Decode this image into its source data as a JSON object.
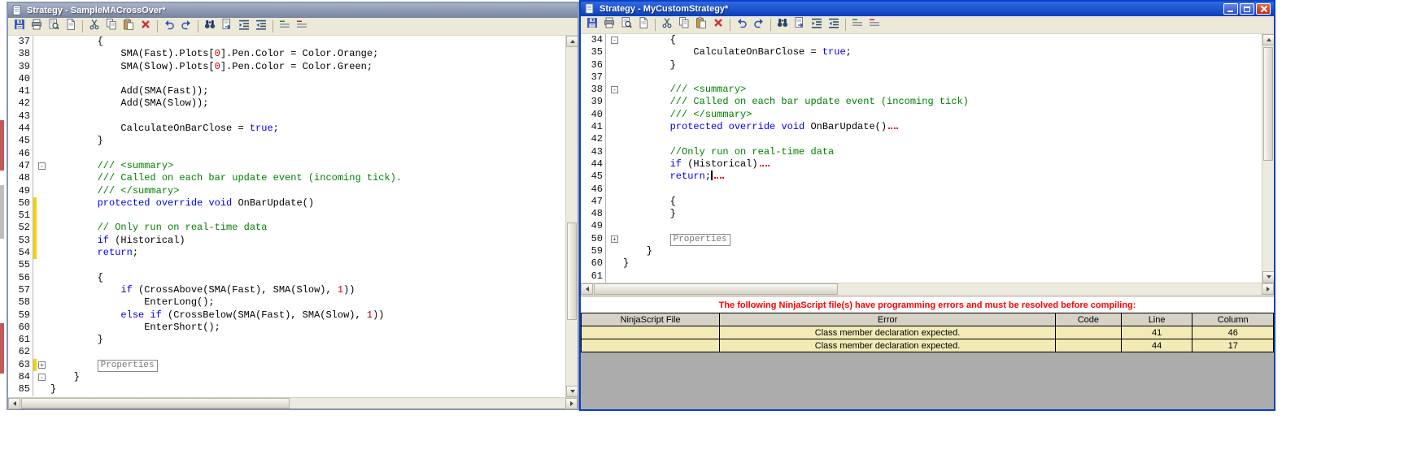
{
  "colors": {
    "keyword": "#0000FF",
    "comment": "#008000",
    "number": "#C00000",
    "error_text": "#FF0000",
    "error_row_bg": "#F2EBB6",
    "table_header_bg": "#D6D2C6",
    "active_title_from": "#2E6BE5",
    "active_title_to": "#0A3EB8",
    "inactive_title_from": "#A8B2C8",
    "inactive_title_to": "#76839E"
  },
  "left_window": {
    "title": "Strategy - SampleMACrossOver*",
    "toolbar": [
      "save",
      "print",
      "print-preview",
      "page-find",
      "sep",
      "cut",
      "copy",
      "paste",
      "delete",
      "sep",
      "undo",
      "redo",
      "sep",
      "find",
      "goto-line",
      "indent",
      "outdent",
      "sep",
      "comment",
      "uncomment"
    ],
    "code_lines": [
      {
        "n": "37",
        "seg": [
          [
            "p",
            "        {"
          ]
        ]
      },
      {
        "n": "38",
        "seg": [
          [
            "p",
            "            SMA(Fast).Plots["
          ],
          [
            "num",
            "0"
          ],
          [
            "p",
            "].Pen.Color = Color.Orange;"
          ]
        ]
      },
      {
        "n": "39",
        "seg": [
          [
            "p",
            "            SMA(Slow).Plots["
          ],
          [
            "num",
            "0"
          ],
          [
            "p",
            "].Pen.Color = Color.Green;"
          ]
        ]
      },
      {
        "n": "40",
        "seg": []
      },
      {
        "n": "41",
        "seg": [
          [
            "p",
            "            Add(SMA(Fast));"
          ]
        ]
      },
      {
        "n": "42",
        "seg": [
          [
            "p",
            "            Add(SMA(Slow));"
          ]
        ]
      },
      {
        "n": "43",
        "seg": []
      },
      {
        "n": "44",
        "seg": [
          [
            "p",
            "            CalculateOnBarClose = "
          ],
          [
            "k",
            "true"
          ],
          [
            "p",
            ";"
          ]
        ]
      },
      {
        "n": "45",
        "seg": [
          [
            "p",
            "        }"
          ]
        ]
      },
      {
        "n": "46",
        "seg": []
      },
      {
        "n": "47",
        "fold": "-",
        "seg": [
          [
            "c",
            "        /// <summary>"
          ]
        ]
      },
      {
        "n": "48",
        "seg": [
          [
            "c",
            "        /// Called on each bar update event (incoming tick)."
          ]
        ]
      },
      {
        "n": "49",
        "seg": [
          [
            "c",
            "        /// </summary>"
          ]
        ]
      },
      {
        "n": "50",
        "chg": true,
        "seg": [
          [
            "p",
            "        "
          ],
          [
            "k",
            "protected"
          ],
          [
            "p",
            " "
          ],
          [
            "k",
            "override"
          ],
          [
            "p",
            " "
          ],
          [
            "k",
            "void"
          ],
          [
            "p",
            " OnBarUpdate()"
          ]
        ]
      },
      {
        "n": "51",
        "chg": true,
        "seg": []
      },
      {
        "n": "52",
        "chg": true,
        "seg": [
          [
            "c",
            "        // Only run on real-time data"
          ]
        ]
      },
      {
        "n": "53",
        "chg": true,
        "seg": [
          [
            "p",
            "        "
          ],
          [
            "k",
            "if"
          ],
          [
            "p",
            " (Historical)"
          ]
        ]
      },
      {
        "n": "54",
        "chg": true,
        "seg": [
          [
            "p",
            "        "
          ],
          [
            "k",
            "return"
          ],
          [
            "p",
            ";"
          ]
        ]
      },
      {
        "n": "55",
        "seg": []
      },
      {
        "n": "56",
        "seg": [
          [
            "p",
            "        {"
          ]
        ]
      },
      {
        "n": "57",
        "seg": [
          [
            "p",
            "            "
          ],
          [
            "k",
            "if"
          ],
          [
            "p",
            " (CrossAbove(SMA(Fast), SMA(Slow), "
          ],
          [
            "num",
            "1"
          ],
          [
            "p",
            "))"
          ]
        ]
      },
      {
        "n": "58",
        "seg": [
          [
            "p",
            "                EnterLong();"
          ]
        ]
      },
      {
        "n": "59",
        "seg": [
          [
            "p",
            "            "
          ],
          [
            "k",
            "else"
          ],
          [
            "p",
            " "
          ],
          [
            "k",
            "if"
          ],
          [
            "p",
            " (CrossBelow(SMA(Fast), SMA(Slow), "
          ],
          [
            "num",
            "1"
          ],
          [
            "p",
            "))"
          ]
        ]
      },
      {
        "n": "60",
        "seg": [
          [
            "p",
            "                EnterShort();"
          ]
        ]
      },
      {
        "n": "61",
        "seg": [
          [
            "p",
            "        }"
          ]
        ]
      },
      {
        "n": "62",
        "seg": []
      },
      {
        "n": "63",
        "fold": "+",
        "chg": true,
        "seg": [
          [
            "p",
            "        "
          ],
          [
            "box",
            "Properties"
          ]
        ]
      },
      {
        "n": "84",
        "fold": "-",
        "seg": [
          [
            "p",
            "    }"
          ]
        ]
      },
      {
        "n": "85",
        "seg": [
          [
            "p",
            "}"
          ]
        ]
      }
    ]
  },
  "right_window": {
    "title": "Strategy - MyCustomStrategy*",
    "window_buttons": [
      "minimize",
      "maximize",
      "close"
    ],
    "toolbar": [
      "save",
      "print",
      "print-preview",
      "page-find",
      "sep",
      "cut",
      "copy",
      "paste",
      "delete",
      "sep",
      "undo",
      "redo",
      "sep",
      "find",
      "goto-line",
      "indent",
      "outdent",
      "sep",
      "comment",
      "uncomment"
    ],
    "code_lines": [
      {
        "n": "34",
        "fold": "-",
        "seg": [
          [
            "p",
            "        {"
          ]
        ]
      },
      {
        "n": "35",
        "seg": [
          [
            "p",
            "            CalculateOnBarClose = "
          ],
          [
            "k",
            "true"
          ],
          [
            "p",
            ";"
          ]
        ]
      },
      {
        "n": "36",
        "seg": [
          [
            "p",
            "        }"
          ]
        ]
      },
      {
        "n": "37",
        "seg": []
      },
      {
        "n": "38",
        "fold": "-",
        "seg": [
          [
            "c",
            "        /// <summary>"
          ]
        ]
      },
      {
        "n": "39",
        "seg": [
          [
            "c",
            "        /// Called on each bar update event (incoming tick)"
          ]
        ]
      },
      {
        "n": "40",
        "seg": [
          [
            "c",
            "        /// </summary>"
          ]
        ]
      },
      {
        "n": "41",
        "seg": [
          [
            "p",
            "        "
          ],
          [
            "k",
            "protected"
          ],
          [
            "p",
            " "
          ],
          [
            "k",
            "override"
          ],
          [
            "p",
            " "
          ],
          [
            "k",
            "void"
          ],
          [
            "p",
            " OnBarUpdate()"
          ],
          [
            "sq",
            ""
          ]
        ]
      },
      {
        "n": "42",
        "seg": []
      },
      {
        "n": "43",
        "seg": [
          [
            "c",
            "        //Only run on real-time data"
          ]
        ]
      },
      {
        "n": "44",
        "seg": [
          [
            "p",
            "        "
          ],
          [
            "k",
            "if"
          ],
          [
            "p",
            " (Historical)"
          ],
          [
            "sq",
            ""
          ]
        ]
      },
      {
        "n": "45",
        "seg": [
          [
            "p",
            "        "
          ],
          [
            "k",
            "return"
          ],
          [
            "p",
            ";"
          ],
          [
            "caret",
            ""
          ],
          [
            "sq",
            ""
          ]
        ]
      },
      {
        "n": "46",
        "seg": []
      },
      {
        "n": "47",
        "seg": [
          [
            "p",
            "        {"
          ]
        ]
      },
      {
        "n": "48",
        "seg": [
          [
            "p",
            "        }"
          ]
        ]
      },
      {
        "n": "49",
        "seg": []
      },
      {
        "n": "50",
        "fold": "+",
        "seg": [
          [
            "p",
            "        "
          ],
          [
            "box",
            "Properties"
          ]
        ]
      },
      {
        "n": "59",
        "seg": [
          [
            "p",
            "    }"
          ]
        ]
      },
      {
        "n": "60",
        "seg": [
          [
            "p",
            "}"
          ]
        ]
      },
      {
        "n": "61",
        "seg": []
      }
    ],
    "error_panel": {
      "message": "The following NinjaScript file(s) have programming errors and must be resolved before compiling:",
      "columns": [
        "NinjaScript File",
        "Error",
        "Code",
        "Line",
        "Column"
      ],
      "rows": [
        {
          "file": "",
          "error": "Class member declaration expected.",
          "code": "",
          "line": "41",
          "column": "46"
        },
        {
          "file": "",
          "error": "Class member declaration expected.",
          "code": "",
          "line": "44",
          "column": "17"
        }
      ]
    }
  }
}
